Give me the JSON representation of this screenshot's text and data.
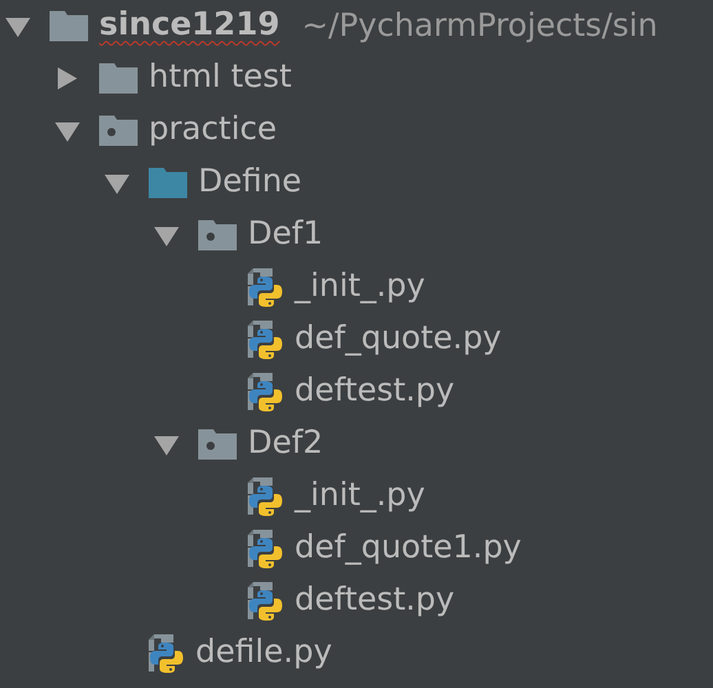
{
  "project_tree": [
    {
      "kind": "folder",
      "name": "since1219",
      "path": "~/PycharmProjects/sin",
      "spellcheck_error": true,
      "expanded": true,
      "children": [
        {
          "kind": "folder",
          "name": "html test",
          "expanded": false
        },
        {
          "kind": "package",
          "name": "practice",
          "expanded": true,
          "children": [
            {
              "kind": "source_folder",
              "name": "Define",
              "expanded": true,
              "children": [
                {
                  "kind": "package",
                  "name": "Def1",
                  "expanded": true,
                  "children": [
                    {
                      "kind": "python_file",
                      "name": "_init_.py"
                    },
                    {
                      "kind": "python_file",
                      "name": "def_quote.py"
                    },
                    {
                      "kind": "python_file",
                      "name": "deftest.py"
                    }
                  ]
                },
                {
                  "kind": "package",
                  "name": "Def2",
                  "expanded": true,
                  "children": [
                    {
                      "kind": "python_file",
                      "name": "_init_.py"
                    },
                    {
                      "kind": "python_file",
                      "name": "def_quote1.py"
                    },
                    {
                      "kind": "python_file",
                      "name": "deftest.py"
                    }
                  ]
                }
              ]
            },
            {
              "kind": "python_file",
              "name": "defile.py"
            }
          ]
        }
      ]
    }
  ]
}
